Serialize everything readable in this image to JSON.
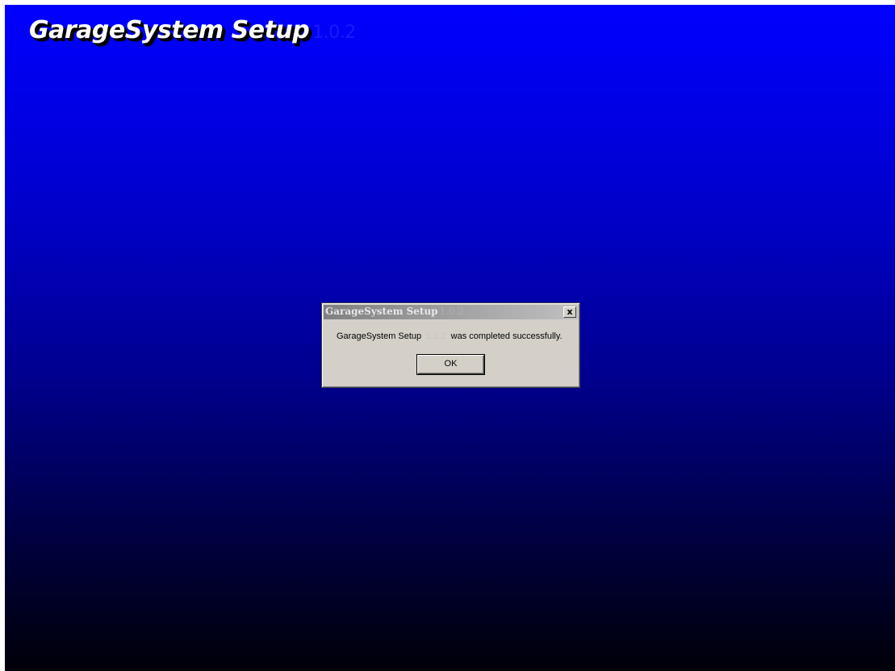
{
  "background": {
    "title": "GarageSystem Setup",
    "title_suffix": "1.0.2",
    "colors": {
      "top": "#0000ff",
      "bottom": "#000008"
    }
  },
  "dialog": {
    "title": "GarageSystem Setup",
    "title_suffix": "1.0.2",
    "close_label": "x",
    "message_prefix": "GarageSystem Setup",
    "message_version": "1.0.2",
    "message_suffix": "was completed successfully.",
    "ok_label": "OK"
  }
}
